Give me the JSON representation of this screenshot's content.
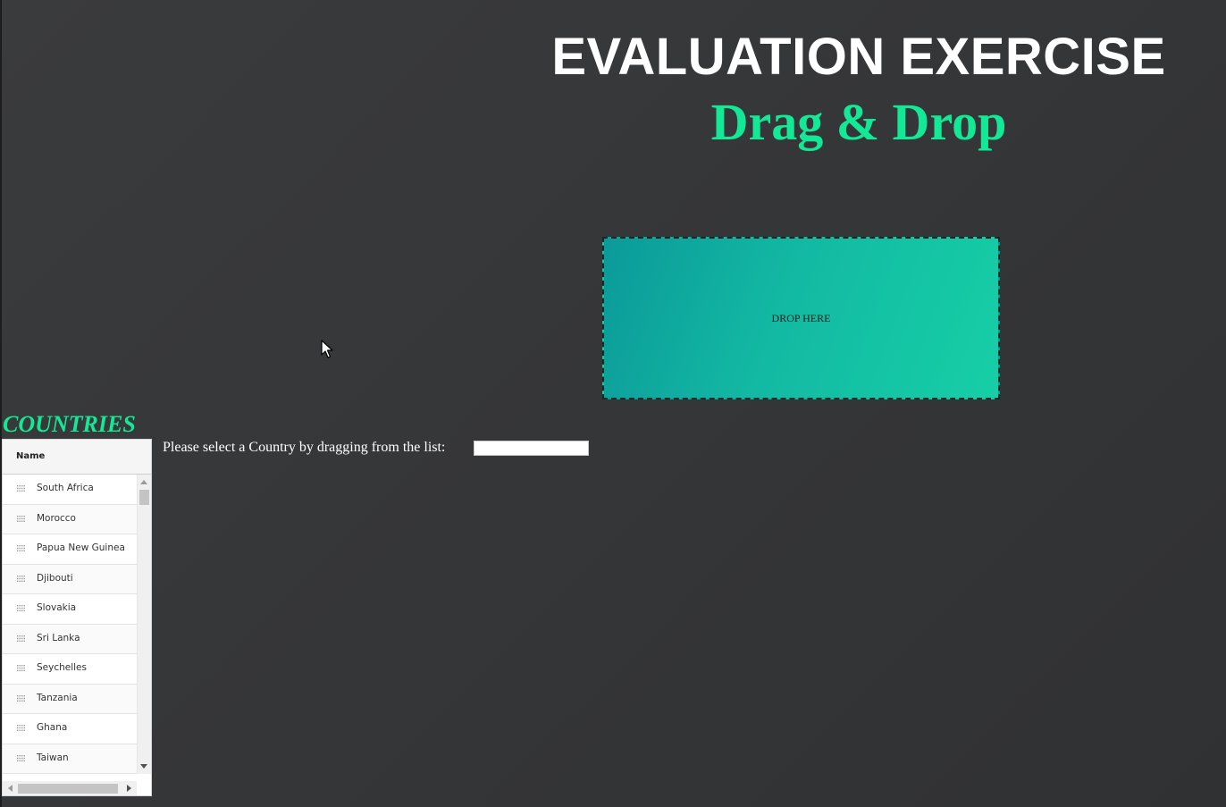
{
  "header": {
    "title": "EVALUATION EXERCISE",
    "subtitle": "Drag & Drop"
  },
  "drop_zone": {
    "label": "DROP HERE"
  },
  "countries": {
    "heading": "COUNTRIES",
    "column_header": "Name",
    "items": [
      "South Africa",
      "Morocco",
      "Papua New Guinea",
      "Djibouti",
      "Slovakia",
      "Sri Lanka",
      "Seychelles",
      "Tanzania",
      "Ghana",
      "Taiwan"
    ]
  },
  "form": {
    "instruction": "Please select a Country by dragging from the list:",
    "input_value": "",
    "input_placeholder": ""
  },
  "colors": {
    "accent": "#12e895",
    "background": "#363739",
    "drop_zone_start": "#0b9a9a",
    "drop_zone_end": "#16cfa6",
    "title": "#ffffff"
  },
  "icons": {
    "cursor": "arrow-cursor-icon",
    "row_handle": "drag-handle-icon"
  }
}
